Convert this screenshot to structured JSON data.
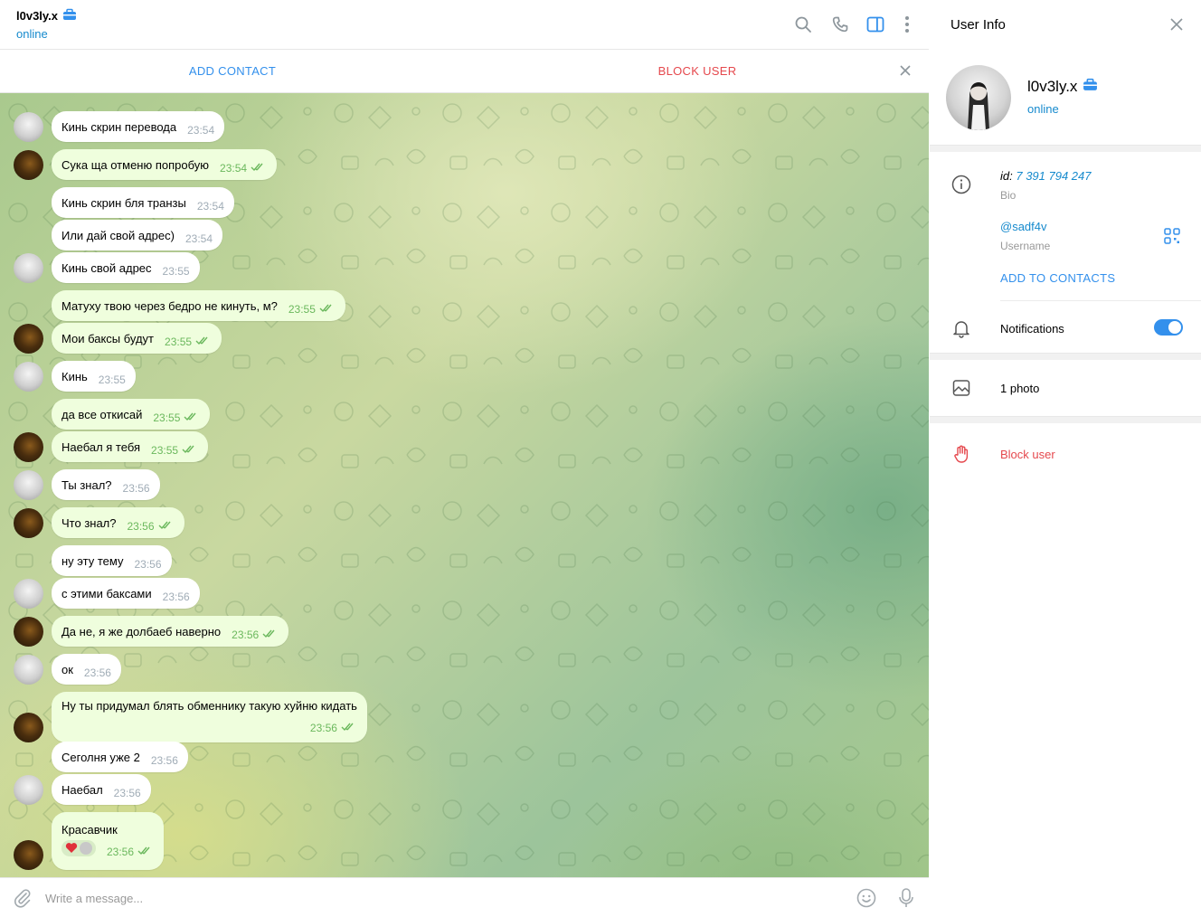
{
  "chat": {
    "title": "l0v3ly.x",
    "status": "online",
    "header_icons": [
      "search-icon",
      "phone-icon",
      "sidebar-toggle-icon",
      "more-icon"
    ]
  },
  "action_bar": {
    "add_contact": "ADD CONTACT",
    "block_user": "BLOCK USER"
  },
  "messages": [
    {
      "sender": "peer",
      "text": "Кинь скрин перевода",
      "time": "23:54",
      "reactions": ""
    },
    {
      "sender": "me",
      "text": "Сука ща отменю попробую",
      "time": "23:54",
      "reactions": ""
    },
    {
      "sender": "peer",
      "text": "Кинь скрин бля транзы",
      "time": "23:54",
      "reactions": ""
    },
    {
      "sender": "peer",
      "text": "Или дай свой адрес)",
      "time": "23:54",
      "reactions": ""
    },
    {
      "sender": "peer",
      "text": "Кинь свой адрес",
      "time": "23:55",
      "reactions": ""
    },
    {
      "sender": "me",
      "text": "Матуху твою через бедро не кинуть, м?",
      "time": "23:55",
      "reactions": ""
    },
    {
      "sender": "me",
      "text": "Мои баксы будут",
      "time": "23:55",
      "reactions": ""
    },
    {
      "sender": "peer",
      "text": "Кинь",
      "time": "23:55",
      "reactions": ""
    },
    {
      "sender": "me",
      "text": "да все откисай",
      "time": "23:55",
      "reactions": ""
    },
    {
      "sender": "me",
      "text": "Наебал я тебя",
      "time": "23:55",
      "reactions": ""
    },
    {
      "sender": "peer",
      "text": "Ты знал?",
      "time": "23:56",
      "reactions": ""
    },
    {
      "sender": "me",
      "text": "Что знал?",
      "time": "23:56",
      "reactions": ""
    },
    {
      "sender": "peer",
      "text": "ну эту тему",
      "time": "23:56",
      "reactions": ""
    },
    {
      "sender": "peer",
      "text": "с этими баксами",
      "time": "23:56",
      "reactions": ""
    },
    {
      "sender": "me",
      "text": "Да не, я же долбаеб наверно",
      "time": "23:56",
      "reactions": ""
    },
    {
      "sender": "peer",
      "text": "ок",
      "time": "23:56",
      "reactions": ""
    },
    {
      "sender": "me",
      "text": "Ну ты придумал блять обменнику такую хуйню кидать",
      "time": "23:56",
      "reactions": ""
    },
    {
      "sender": "peer",
      "text": "Сеголня уже 2",
      "time": "23:56",
      "reactions": ""
    },
    {
      "sender": "peer",
      "text": "Наебал",
      "time": "23:56",
      "reactions": ""
    },
    {
      "sender": "me",
      "text": "Красавчик",
      "time": "23:56",
      "reactions": "heart-reaction"
    }
  ],
  "composer": {
    "placeholder": "Write a message..."
  },
  "user_info": {
    "title": "User Info",
    "name": "l0v3ly.x",
    "status": "online",
    "id_label": "id:",
    "id_value": "7 391 794 247",
    "bio_label": "Bio",
    "username": "@sadf4v",
    "username_label": "Username",
    "add_to_contacts": "ADD TO CONTACTS",
    "notifications": "Notifications",
    "notifications_on": true,
    "photos": "1 photo",
    "block": "Block user"
  },
  "colors": {
    "accent": "#3390ec",
    "status": "#168acd",
    "danger": "#e5484d",
    "outgoing_bubble": "#effedd",
    "read_check": "#6bb85d"
  }
}
